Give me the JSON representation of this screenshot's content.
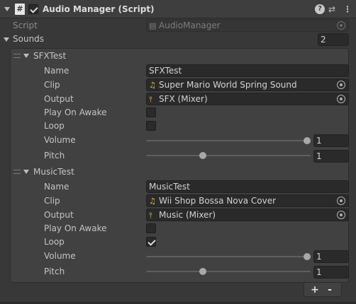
{
  "header": {
    "title": "Audio Manager (Script)",
    "enabled": true,
    "script_icon": "#",
    "help_icon": "?",
    "presets_icon": "⇄",
    "menu_icon": "⋮"
  },
  "script_field": {
    "label": "Script",
    "value": "AudioManager"
  },
  "sounds": {
    "label": "Sounds",
    "size": "2",
    "items": [
      {
        "header": "SFXTest",
        "name_label": "Name",
        "name": "SFXTest",
        "clip_label": "Clip",
        "clip": "Super Mario World   Spring Sound",
        "output_label": "Output",
        "output": "SFX (Mixer)",
        "play_on_awake_label": "Play On Awake",
        "play_on_awake": false,
        "loop_label": "Loop",
        "loop": false,
        "volume_label": "Volume",
        "volume": "1",
        "volume_fraction": 1.0,
        "pitch_label": "Pitch",
        "pitch": "1",
        "pitch_fraction": 0.33
      },
      {
        "header": "MusicTest",
        "name_label": "Name",
        "name": "MusicTest",
        "clip_label": "Clip",
        "clip": "Wii Shop Bossa Nova Cover",
        "output_label": "Output",
        "output": "Music (Mixer)",
        "play_on_awake_label": "Play On Awake",
        "play_on_awake": false,
        "loop_label": "Loop",
        "loop": true,
        "volume_label": "Volume",
        "volume": "1",
        "volume_fraction": 1.0,
        "pitch_label": "Pitch",
        "pitch": "1",
        "pitch_fraction": 0.33
      }
    ],
    "add_label": "+",
    "remove_label": "-"
  },
  "colors": {
    "background": "#383838",
    "field": "#2a2a2a",
    "audio_clip_icon": "#e8c04a"
  }
}
